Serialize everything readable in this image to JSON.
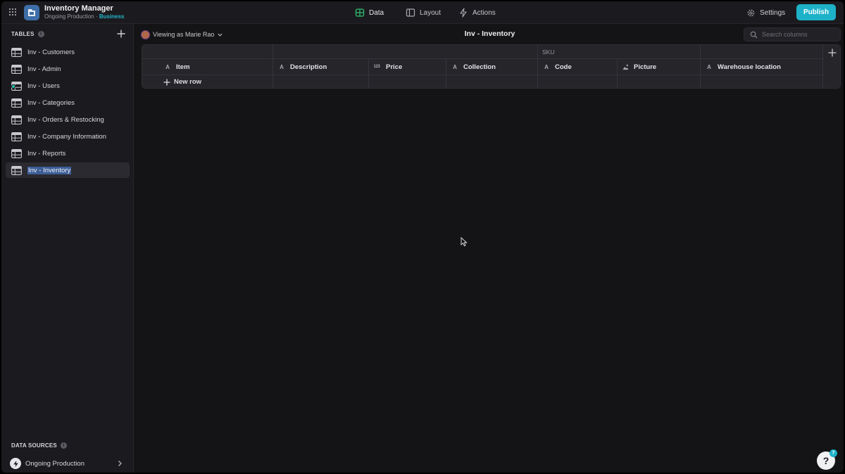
{
  "app": {
    "title": "Inventory Manager",
    "subtitle_prefix": "Ongoing Production · ",
    "subtitle_plan": "Business"
  },
  "nav": {
    "tabs": [
      {
        "label": "Data",
        "icon": "table-icon",
        "active": true
      },
      {
        "label": "Layout",
        "icon": "layout-icon",
        "active": false
      },
      {
        "label": "Actions",
        "icon": "lightning-icon",
        "active": false
      }
    ],
    "settings_label": "Settings",
    "publish_label": "Publish"
  },
  "sidebar": {
    "tables_heading": "TABLES",
    "items": [
      {
        "label": "Inv - Customers",
        "selected": false
      },
      {
        "label": "Inv - Admin",
        "selected": false
      },
      {
        "label": "Inv - Users",
        "selected": false,
        "user_badge": true
      },
      {
        "label": "Inv - Categories",
        "selected": false
      },
      {
        "label": "Inv - Orders & Restocking",
        "selected": false
      },
      {
        "label": "Inv - Company Information",
        "selected": false
      },
      {
        "label": "Inv - Reports",
        "selected": false
      },
      {
        "label": "Inv - Inventory",
        "selected": true
      }
    ],
    "data_sources_heading": "DATA SOURCES",
    "data_source": "Ongoing Production"
  },
  "main": {
    "viewing_as": "Viewing as Marie Rao",
    "title": "Inv - Inventory",
    "search_placeholder": "Search columns",
    "group_label": "SKU",
    "columns": [
      {
        "name": "Item",
        "type": "A"
      },
      {
        "name": "Description",
        "type": "A"
      },
      {
        "name": "Price",
        "type": "123"
      },
      {
        "name": "Collection",
        "type": "A"
      },
      {
        "name": "Code",
        "type": "A"
      },
      {
        "name": "Picture",
        "type": "image"
      },
      {
        "name": "Warehouse location",
        "type": "A"
      }
    ],
    "new_row_label": "New row"
  },
  "help": {
    "label": "?",
    "badge": "7"
  },
  "colors": {
    "accent": "#1eb2c9",
    "selection": "#3c5e96",
    "data_tab": "#2fbf71"
  }
}
